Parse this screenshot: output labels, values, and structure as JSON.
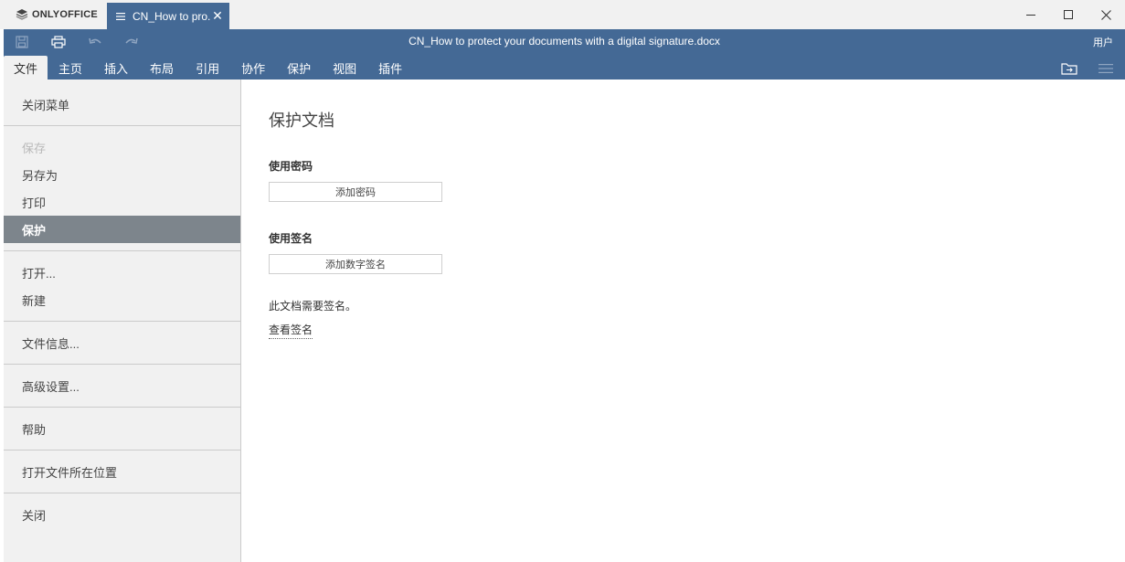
{
  "app": {
    "logo_text": "ONLYOFFICE",
    "tab_title": "CN_How to pro...",
    "window_controls": [
      "minimize-icon",
      "maximize-icon",
      "close-icon"
    ]
  },
  "header": {
    "doc_title": "CN_How to protect your documents with a digital signature.docx",
    "user_label": "用户",
    "quick_access": [
      "save-icon",
      "print-icon",
      "undo-icon",
      "redo-icon"
    ],
    "tabs": [
      {
        "label": "文件",
        "active": true
      },
      {
        "label": "主页"
      },
      {
        "label": "插入"
      },
      {
        "label": "布局"
      },
      {
        "label": "引用"
      },
      {
        "label": "协作"
      },
      {
        "label": "保护"
      },
      {
        "label": "视图"
      },
      {
        "label": "插件"
      }
    ],
    "right_icons": [
      "open-location-icon",
      "hamburger-menu-icon"
    ],
    "colors": {
      "accent": "#446995",
      "panel": "#f1f1f1",
      "selected": "#7d858c"
    }
  },
  "file_menu": {
    "close_menu": "关闭菜单",
    "save": "保存",
    "save_as": "另存为",
    "print": "打印",
    "protect": "保护",
    "open": "打开...",
    "new": "新建",
    "file_info": "文件信息...",
    "advanced_settings": "高级设置...",
    "help": "帮助",
    "open_file_location": "打开文件所在位置",
    "close": "关闭"
  },
  "protect_panel": {
    "title": "保护文档",
    "password_section": "使用密码",
    "add_password_button": "添加密码",
    "signature_section": "使用签名",
    "add_signature_button": "添加数字签名",
    "signature_note": "此文档需要签名。",
    "view_signature_link": "查看签名"
  }
}
